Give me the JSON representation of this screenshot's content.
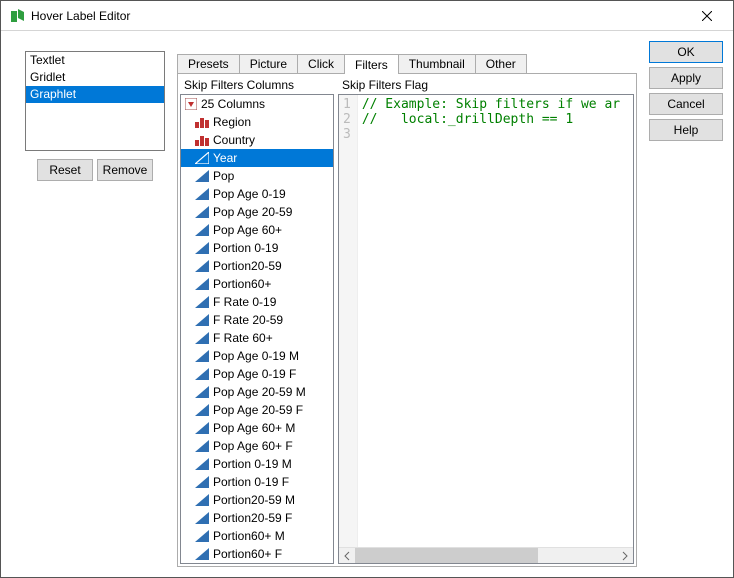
{
  "window": {
    "title": "Hover Label Editor"
  },
  "listbox": {
    "items": [
      {
        "label": "Textlet",
        "selected": false
      },
      {
        "label": "Gridlet",
        "selected": false
      },
      {
        "label": "Graphlet",
        "selected": true
      }
    ]
  },
  "leftButtons": {
    "reset": "Reset",
    "remove": "Remove"
  },
  "tabs": {
    "items": [
      "Presets",
      "Picture",
      "Click",
      "Filters",
      "Thumbnail",
      "Other"
    ],
    "selected": 3
  },
  "filtersPanel": {
    "leftHeader": "Skip Filters Columns",
    "rightHeader": "Skip Filters Flag",
    "rootLabel": "25 Columns",
    "columns": [
      {
        "label": "Region",
        "icon": "nominal",
        "selected": false
      },
      {
        "label": "Country",
        "icon": "nominal",
        "selected": false
      },
      {
        "label": "Year",
        "icon": "ordinal",
        "selected": true
      },
      {
        "label": "Pop",
        "icon": "continuous",
        "selected": false
      },
      {
        "label": "Pop Age 0-19",
        "icon": "continuous",
        "selected": false
      },
      {
        "label": "Pop Age 20-59",
        "icon": "continuous",
        "selected": false
      },
      {
        "label": "Pop Age 60+",
        "icon": "continuous",
        "selected": false
      },
      {
        "label": "Portion 0-19",
        "icon": "continuous",
        "selected": false
      },
      {
        "label": "Portion20-59",
        "icon": "continuous",
        "selected": false
      },
      {
        "label": "Portion60+",
        "icon": "continuous",
        "selected": false
      },
      {
        "label": "F Rate 0-19",
        "icon": "continuous",
        "selected": false
      },
      {
        "label": "F Rate 20-59",
        "icon": "continuous",
        "selected": false
      },
      {
        "label": "F Rate 60+",
        "icon": "continuous",
        "selected": false
      },
      {
        "label": "Pop Age 0-19 M",
        "icon": "continuous",
        "selected": false
      },
      {
        "label": "Pop Age 0-19 F",
        "icon": "continuous",
        "selected": false
      },
      {
        "label": "Pop Age 20-59 M",
        "icon": "continuous",
        "selected": false
      },
      {
        "label": "Pop Age 20-59 F",
        "icon": "continuous",
        "selected": false
      },
      {
        "label": "Pop Age 60+ M",
        "icon": "continuous",
        "selected": false
      },
      {
        "label": "Pop Age 60+ F",
        "icon": "continuous",
        "selected": false
      },
      {
        "label": "Portion 0-19 M",
        "icon": "continuous",
        "selected": false
      },
      {
        "label": "Portion 0-19 F",
        "icon": "continuous",
        "selected": false
      },
      {
        "label": "Portion20-59 M",
        "icon": "continuous",
        "selected": false
      },
      {
        "label": "Portion20-59 F",
        "icon": "continuous",
        "selected": false
      },
      {
        "label": "Portion60+ M",
        "icon": "continuous",
        "selected": false
      },
      {
        "label": "Portion60+ F",
        "icon": "continuous",
        "selected": false
      }
    ],
    "code": {
      "lines": [
        "// Example: Skip filters if we ar",
        "//   local:_drillDepth == 1",
        ""
      ]
    }
  },
  "rightButtons": {
    "ok": "OK",
    "apply": "Apply",
    "cancel": "Cancel",
    "help": "Help"
  }
}
